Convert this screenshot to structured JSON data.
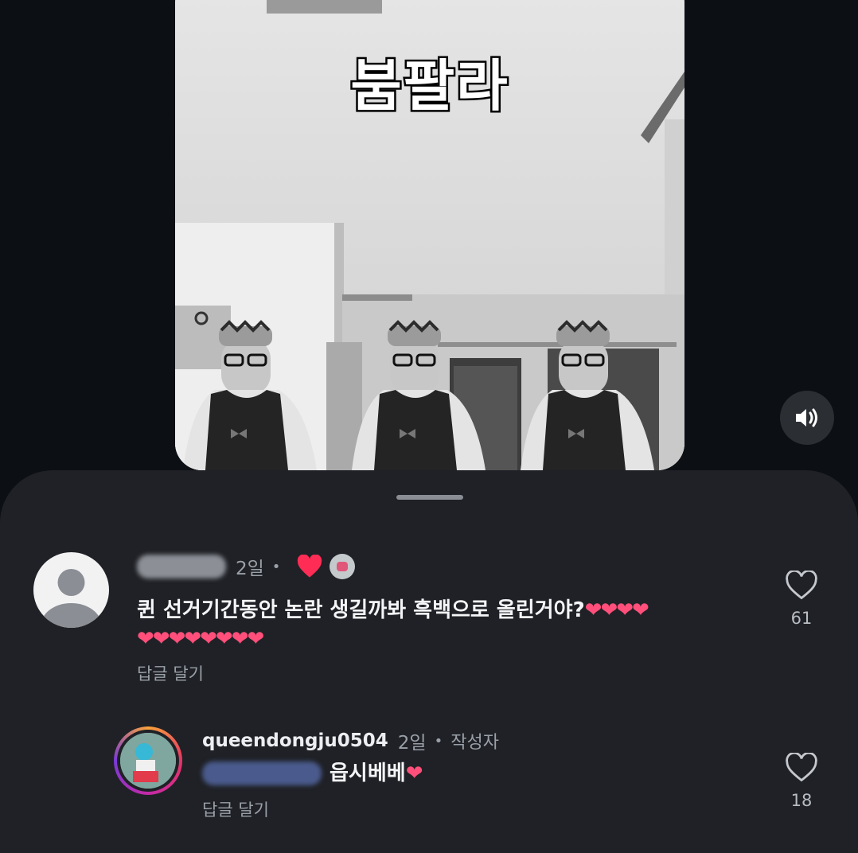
{
  "video": {
    "caption": "붐팔라",
    "sound_icon": "speaker-volume-icon"
  },
  "comments": [
    {
      "username": "",
      "username_blurred": true,
      "time": "2일",
      "liked_by_author_icon": "red-heart-icon",
      "text": "퀸 선거기간동안 논란 생길까봐 흑백으로 올린거야?",
      "text_hearts": "❤❤❤❤",
      "text_hearts_line2": "❤❤❤❤❤❤❤❤",
      "reply_label": "답글 달기",
      "like_count": "61"
    },
    {
      "username": "queendongju0504",
      "time": "2일",
      "author_badge": "작성자",
      "mention_blurred": true,
      "text": "읍시베베",
      "text_hearts": "❤",
      "reply_label": "답글 달기",
      "like_count": "18"
    }
  ],
  "colors": {
    "sheet_bg": "#1f2126",
    "page_bg": "#0c0f14",
    "like_heart": "#ff2d55",
    "text_heart": "#ff4f7a",
    "story_ring": "#e63466"
  }
}
